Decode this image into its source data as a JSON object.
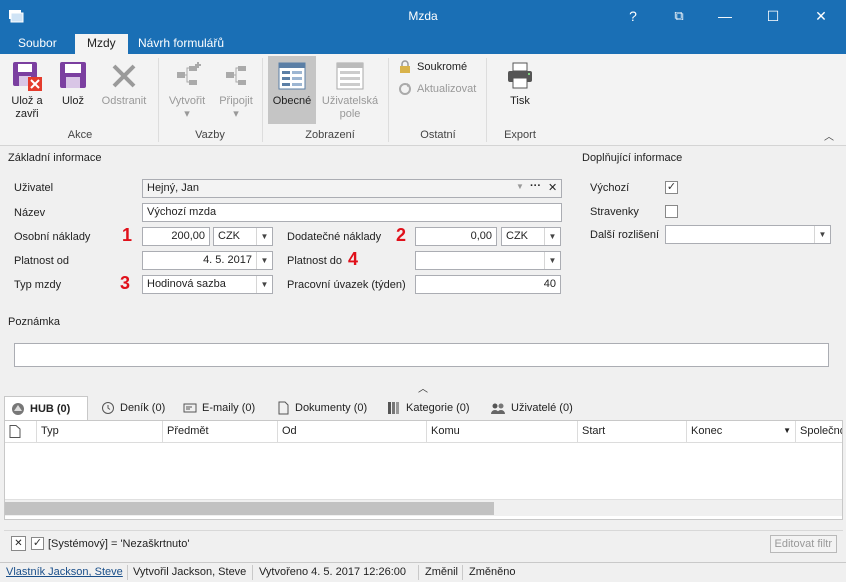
{
  "window": {
    "title": "Mzda",
    "help_glyph": "?",
    "restore_glyph": "⧉",
    "minimize_glyph": "—",
    "maximize_glyph": "☐",
    "close_glyph": "✕"
  },
  "menu_tabs": [
    "Soubor",
    "Mzdy",
    "Návrh formulářů"
  ],
  "ribbon": {
    "save_close": [
      "Ulož a",
      "zavři"
    ],
    "save": "Ulož",
    "delete": "Odstranit",
    "group_akce": "Akce",
    "create": "Vytvořit",
    "attach": "Připojit",
    "group_vazby": "Vazby",
    "general": "Obecné",
    "user_fields": [
      "Uživatelská",
      "pole"
    ],
    "group_zobrazeni": "Zobrazení",
    "private": "Soukromé",
    "refresh": "Aktualizovat",
    "group_ostatni": "Ostatní",
    "print": "Tisk",
    "group_export": "Export",
    "dropdown_glyph": "▾",
    "collapse_glyph": "︿"
  },
  "form": {
    "basic_title": "Základní informace",
    "extra_title": "Doplňující informace",
    "user_label": "Uživatel",
    "user_value": "Hejný, Jan",
    "user_more": "···",
    "user_clear": "✕",
    "name_label": "Název",
    "name_value": "Výchozí mzda",
    "personal_cost_label": "Osobní náklady",
    "personal_cost_value": "200,00",
    "currency1": "CZK",
    "additional_cost_label": "Dodatečné náklady",
    "additional_cost_value": "0,00",
    "currency2": "CZK",
    "valid_from_label": "Platnost od",
    "valid_from_value": "4. 5. 2017",
    "valid_to_label": "Platnost do",
    "valid_to_value": "",
    "wage_type_label": "Typ mzdy",
    "wage_type_value": "Hodinová sazba",
    "workload_label": "Pracovní úvazek (týden)",
    "workload_value": "40",
    "default_label": "Výchozí",
    "default_checked_glyph": "✓",
    "vouchers_label": "Stravenky",
    "other_label": "Další rozlišení",
    "other_value": "",
    "note_label": "Poznámka",
    "note_value": "",
    "dropdown_glyph": "▼",
    "expand_glyph": "︿"
  },
  "markers": [
    "1",
    "2",
    "3",
    "4"
  ],
  "subtabs": [
    "HUB (0)",
    "Deník (0)",
    "E-maily (0)",
    "Dokumenty (0)",
    "Kategorie (0)",
    "Uživatelé (0)"
  ],
  "grid": {
    "columns": [
      "Typ",
      "Předmět",
      "Od",
      "Komu",
      "Start",
      "Konec",
      "Společno"
    ],
    "sort_glyph": "▼",
    "rows": []
  },
  "filter": {
    "text": "[Systémový] = 'Nezaškrtnuto'",
    "edit_button": "Editovat filtr",
    "clear_glyph": "✕",
    "checked_glyph": "✓"
  },
  "status": {
    "owner": "Vlastník Jackson, Steve",
    "created_by": "Vytvořil Jackson, Steve",
    "created_at": "Vytvořeno 4. 5. 2017 12:26:00",
    "changed_by": "Změnil",
    "changed_at": "Změněno"
  },
  "colors": {
    "titlebar": "#1a6fb5",
    "marker": "#e0101a",
    "save_icon": "#7b3fa0"
  }
}
